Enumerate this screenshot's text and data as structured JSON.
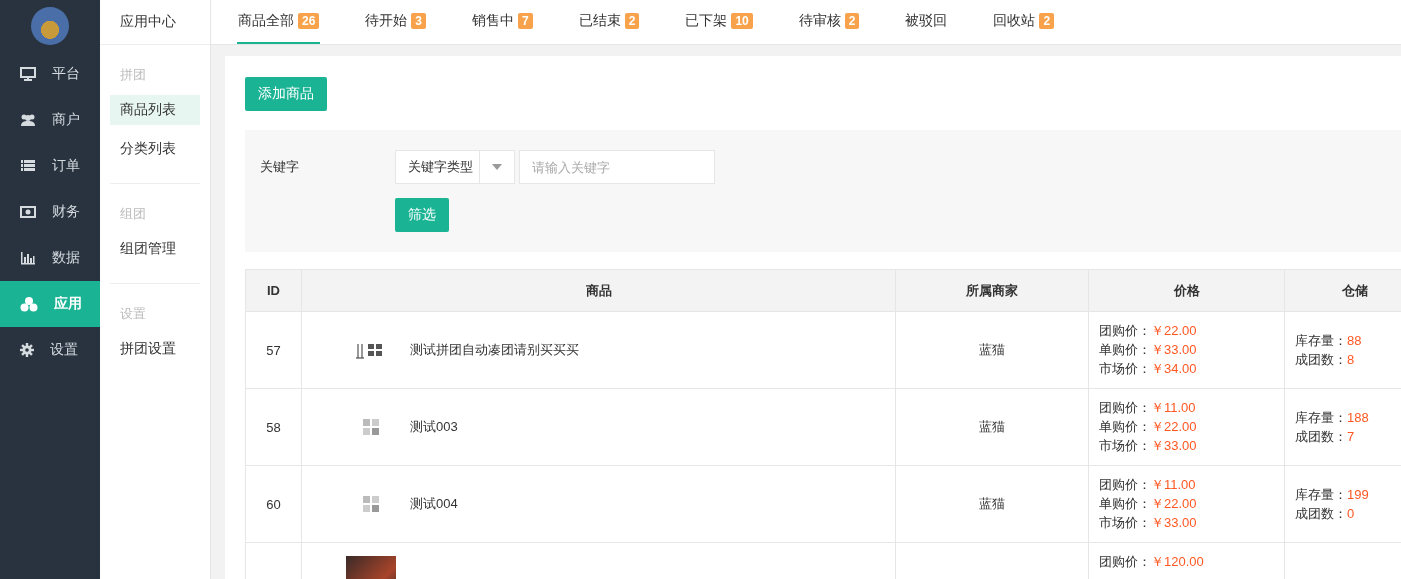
{
  "nav": [
    {
      "label": "平台",
      "selected": false
    },
    {
      "label": "商户",
      "selected": false
    },
    {
      "label": "订单",
      "selected": false
    },
    {
      "label": "财务",
      "selected": false
    },
    {
      "label": "数据",
      "selected": false
    },
    {
      "label": "应用",
      "selected": true
    },
    {
      "label": "设置",
      "selected": false
    }
  ],
  "subnav": {
    "title": "应用中心",
    "groups": [
      {
        "heading": "拼团",
        "items": [
          {
            "label": "商品列表",
            "selected": true
          },
          {
            "label": "分类列表",
            "selected": false
          }
        ]
      },
      {
        "heading": "组团",
        "items": [
          {
            "label": "组团管理",
            "selected": false
          }
        ]
      },
      {
        "heading": "设置",
        "items": [
          {
            "label": "拼团设置",
            "selected": false
          }
        ]
      }
    ]
  },
  "tabs": [
    {
      "label": "商品全部",
      "count": "26",
      "selected": true
    },
    {
      "label": "待开始",
      "count": "3",
      "selected": false
    },
    {
      "label": "销售中",
      "count": "7",
      "selected": false
    },
    {
      "label": "已结束",
      "count": "2",
      "selected": false
    },
    {
      "label": "已下架",
      "count": "10",
      "selected": false
    },
    {
      "label": "待审核",
      "count": "2",
      "selected": false
    },
    {
      "label": "被驳回",
      "selected": false
    },
    {
      "label": "回收站",
      "count": "2",
      "selected": false
    }
  ],
  "add_button": "添加商品",
  "filter": {
    "label": "关键字",
    "select": "关键字类型",
    "placeholder": "请输入关键字",
    "button": "筛选"
  },
  "table": {
    "columns": [
      "ID",
      "商品",
      "所属商家",
      "价格",
      "仓储"
    ],
    "rows": [
      {
        "id": "57",
        "name": "测试拼团自动凑团请别买买买",
        "merchant": "蓝猫",
        "prices": [
          {
            "label": "团购价：",
            "value": "￥22.00"
          },
          {
            "label": "单购价：",
            "value": "￥33.00"
          },
          {
            "label": "市场价：",
            "value": "￥34.00"
          }
        ],
        "stock": [
          {
            "label": "库存量：",
            "value": "88"
          },
          {
            "label": "成团数：",
            "value": "8"
          }
        ]
      },
      {
        "id": "58",
        "name": "测试003",
        "merchant": "蓝猫",
        "prices": [
          {
            "label": "团购价：",
            "value": "￥11.00"
          },
          {
            "label": "单购价：",
            "value": "￥22.00"
          },
          {
            "label": "市场价：",
            "value": "￥33.00"
          }
        ],
        "stock": [
          {
            "label": "库存量：",
            "value": "188"
          },
          {
            "label": "成团数：",
            "value": "7"
          }
        ]
      },
      {
        "id": "60",
        "name": "测试004",
        "merchant": "蓝猫",
        "prices": [
          {
            "label": "团购价：",
            "value": "￥11.00"
          },
          {
            "label": "单购价：",
            "value": "￥22.00"
          },
          {
            "label": "市场价：",
            "value": "￥33.00"
          }
        ],
        "stock": [
          {
            "label": "库存量：",
            "value": "199"
          },
          {
            "label": "成团数：",
            "value": "0"
          }
        ]
      },
      {
        "prices": [
          {
            "label": "团购价：",
            "value": "￥120.00"
          }
        ]
      }
    ]
  }
}
